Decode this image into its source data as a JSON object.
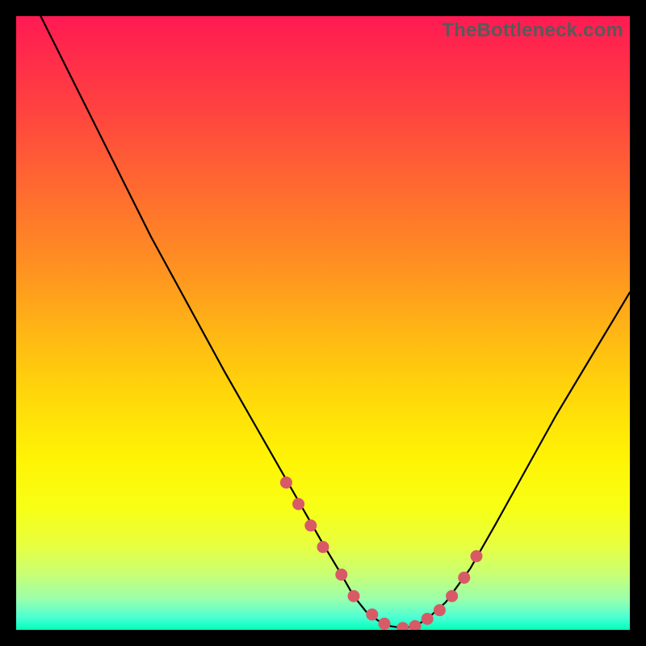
{
  "watermark": "TheBottleneck.com",
  "colors": {
    "curve": "#000000",
    "dot": "#d85a66"
  },
  "chart_data": {
    "type": "line",
    "title": "",
    "xlabel": "",
    "ylabel": "",
    "xlim": [
      0,
      100
    ],
    "ylim": [
      0,
      100
    ],
    "note": "Chart has no axis ticks or numeric labels. X and Y are normalized 0–100. Curve descends from top-left to a flat minimum near y≈0 around x≈55–65, then rises toward the right. Dots highlight the region approaching, at, and leaving the minimum.",
    "series": [
      {
        "name": "bottleneck-curve",
        "x": [
          4,
          10,
          16,
          22,
          28,
          34,
          38,
          42,
          46,
          50,
          53,
          55,
          57,
          59,
          61,
          63,
          65,
          67,
          70,
          74,
          78,
          83,
          88,
          94,
          100
        ],
        "y": [
          100,
          88,
          76,
          64,
          53,
          42,
          35,
          28,
          21,
          14,
          9,
          5.5,
          3,
          1.5,
          0.6,
          0.3,
          0.6,
          1.8,
          4.5,
          10,
          17,
          26,
          35,
          45,
          55
        ]
      }
    ],
    "dots": {
      "name": "highlight-dots",
      "x": [
        44,
        46,
        48,
        50,
        53,
        55,
        58,
        60,
        63,
        65,
        67,
        69,
        71,
        73,
        75
      ],
      "y": [
        24,
        20.5,
        17,
        13.5,
        9,
        5.5,
        2.5,
        1,
        0.3,
        0.6,
        1.8,
        3.2,
        5.5,
        8.5,
        12
      ]
    }
  }
}
